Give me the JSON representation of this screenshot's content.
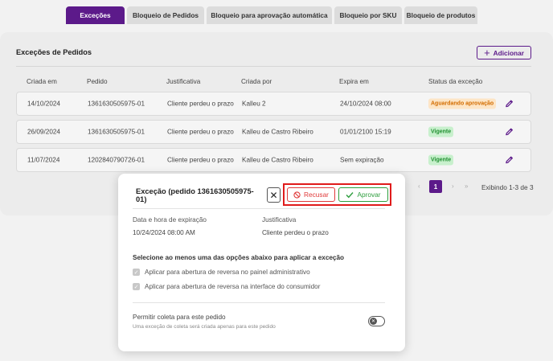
{
  "tabs": [
    {
      "label": "Exceções",
      "active": true
    },
    {
      "label": "Bloqueio de Pedidos",
      "active": false
    },
    {
      "label": "Bloqueio para aprovação automática",
      "active": false
    },
    {
      "label": "Bloqueio por SKU",
      "active": false
    },
    {
      "label": "Bloqueio de produtos",
      "active": false
    }
  ],
  "card": {
    "title": "Exceções de Pedidos",
    "add_label": "Adicionar"
  },
  "table": {
    "headers": [
      "Criada em",
      "Pedido",
      "Justificativa",
      "Criada por",
      "Expira em",
      "Status da exceção"
    ],
    "rows": [
      {
        "created": "14/10/2024",
        "order": "1361630505975-01",
        "justification": "Cliente perdeu o prazo",
        "created_by": "Kalleu 2",
        "expires": "24/10/2024 08:00",
        "status": "Aguardando aprovação",
        "status_kind": "warn"
      },
      {
        "created": "26/09/2024",
        "order": "1361630505975-01",
        "justification": "Cliente perdeu o prazo",
        "created_by": "Kalleu de Castro Ribeiro",
        "expires": "01/01/2100 15:19",
        "status": "Vigente",
        "status_kind": "ok"
      },
      {
        "created": "11/07/2024",
        "order": "1202840790726-01",
        "justification": "Cliente perdeu o prazo",
        "created_by": "Kalleu de Castro Ribeiro",
        "expires": "Sem expiração",
        "status": "Vigente",
        "status_kind": "ok"
      }
    ]
  },
  "pagination": {
    "prev_label": "‹",
    "first_label": "«",
    "current_page": "1",
    "next_label": "›",
    "last_label": "»",
    "showing": "Exibindo 1-3 de 3"
  },
  "modal": {
    "title": "Exceção (pedido 1361630505975-01)",
    "refuse_label": "Recusar",
    "approve_label": "Aprovar",
    "expiration_label": "Data e hora de expiração",
    "expiration_value": "10/24/2024 08:00 AM",
    "justification_label": "Justificativa",
    "justification_value": "Cliente perdeu o prazo",
    "instruction": "Selecione ao menos uma das opções abaixo para aplicar a exceção",
    "options": [
      "Aplicar para abertura de reversa no painel administrativo",
      "Aplicar para abertura de reversa na interface do consumidor"
    ],
    "collect_label": "Permitir coleta para este pedido",
    "collect_hint": "Uma exceção de coleta será criada apenas para este pedido"
  },
  "colors": {
    "brand": "#5c1a8a",
    "warn_bg": "#fde5c6",
    "warn_text": "#d36d00",
    "ok_bg": "#c8f0cd",
    "ok_text": "#1f8f2f",
    "refuse": "#e03a3a",
    "approve": "#2e9e3e",
    "highlight": "#e01b1b"
  }
}
